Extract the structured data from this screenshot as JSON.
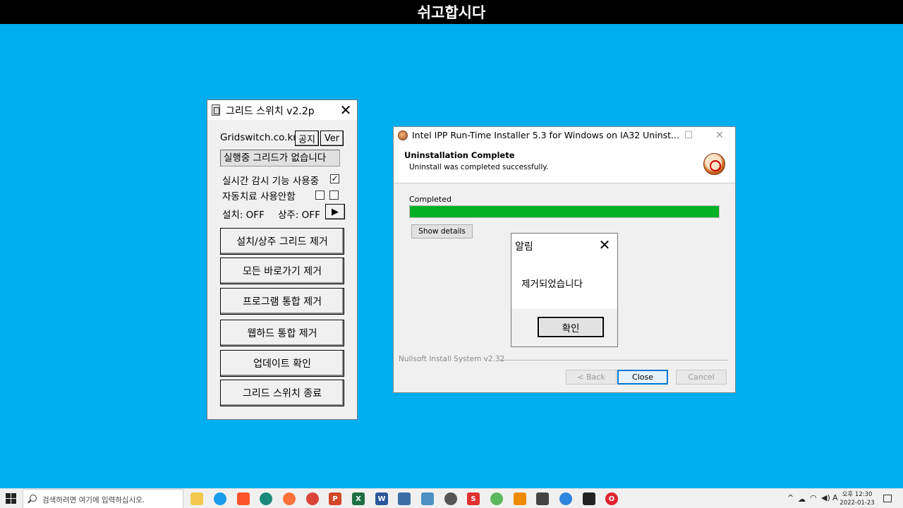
{
  "banner": {
    "title": "쉬고합시다"
  },
  "gridswitch": {
    "title": "그리드 스위치 v2.2p",
    "close": "✕",
    "site": "Gridswitch.co.kr",
    "notice_btn": "공지",
    "ver_btn": "Ver",
    "status": "실행중 그리드가 없습니다",
    "realtime_label": "실시간 감시 기능 사용중",
    "realtime_checked": "✓",
    "autocure_label": "자동치료 사용안함",
    "install_state": "설치: OFF",
    "resident_state": "상주: OFF",
    "play": "▶",
    "buttons": [
      "설치/상주 그리드 제거",
      "모든 바로가기 제거",
      "프로그램 통합 제거",
      "웹하드 통합 제거",
      "업데이트 확인",
      "그리드 스위치 종료"
    ]
  },
  "installer": {
    "title": "Intel IPP Run-Time Installer 5.3 for Windows on IA32 Uninst...",
    "min": "—",
    "max": "☐",
    "close": "✕",
    "heading": "Uninstallation Complete",
    "subheading": "Uninstall was completed successfully.",
    "progress_label": "Completed",
    "progress": 1.0,
    "show_details": "Show details",
    "nsis": "Nullsoft Install System v2.32",
    "back": "< Back",
    "close_btn": "Close",
    "cancel": "Cancel"
  },
  "alert": {
    "title": "알림",
    "close": "✕",
    "message": "제거되었습니다",
    "ok": "확인"
  },
  "taskbar": {
    "search_placeholder": "검색하려면 여기에 입력하십시오.",
    "apps": [
      "file-explorer",
      "edge",
      "brave",
      "app",
      "firefox",
      "chrome",
      "powerpoint",
      "excel",
      "word",
      "app",
      "app",
      "app",
      "app",
      "app",
      "vlc",
      "calculator",
      "app",
      "app",
      "opera"
    ],
    "tray_caret": "^",
    "ime": "A",
    "time": "오후 12:30",
    "date": "2022-01-23"
  }
}
